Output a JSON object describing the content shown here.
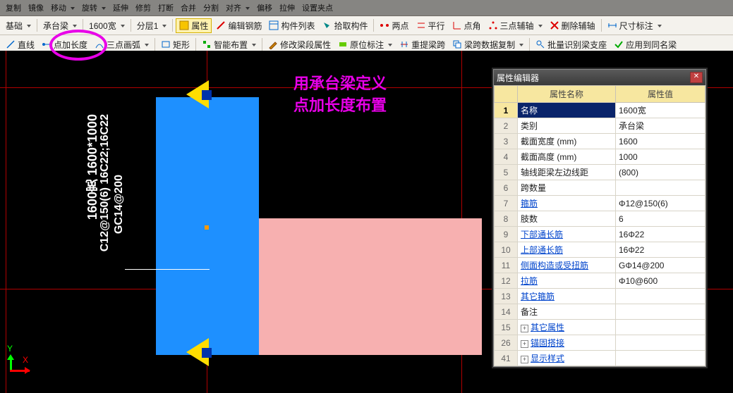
{
  "tb_top": {
    "items": [
      "复制",
      "镜像",
      "移动",
      "旋转",
      "延伸",
      "修剪",
      "打断",
      "合并",
      "分割",
      "对齐",
      "偏移",
      "拉伸",
      "设置夹点"
    ]
  },
  "tb1": {
    "a": "基础",
    "b": "承台梁",
    "c": "1600宽",
    "d": "分层1",
    "prop": "属性",
    "items": [
      "编辑钢筋",
      "构件列表",
      "拾取构件",
      "两点",
      "平行",
      "点角",
      "三点辅轴",
      "删除辅轴",
      "尺寸标注"
    ]
  },
  "tb2": {
    "a": "直线",
    "b": "点加长度",
    "c": "三点画弧",
    "d": "矩形",
    "items": [
      "智能布置",
      "修改梁段属性",
      "原位标注",
      "重提梁跨",
      "梁跨数据复制",
      "批量识别梁支座",
      "应用到同名梁"
    ]
  },
  "anno": {
    "l1": "用承台梁定义",
    "l2": "点加长度布置"
  },
  "vtxt": {
    "a": "1600宽 1600*1000",
    "b": "C12@150(6) 16C22;16C22",
    "c": "GC14@200"
  },
  "axis": {
    "x": "X",
    "y": "Y"
  },
  "panel": {
    "title": "属性编辑器",
    "h1": "属性名称",
    "h2": "属性值",
    "rows": [
      {
        "i": "1",
        "n": "名称",
        "v": "1600宽",
        "sel": true
      },
      {
        "i": "2",
        "n": "类别",
        "v": "承台梁"
      },
      {
        "i": "3",
        "n": "截面宽度 (mm)",
        "v": "1600"
      },
      {
        "i": "4",
        "n": "截面高度 (mm)",
        "v": "1000"
      },
      {
        "i": "5",
        "n": "轴线距梁左边线距",
        "v": "(800)"
      },
      {
        "i": "6",
        "n": "跨数量",
        "v": ""
      },
      {
        "i": "7",
        "n": "箍筋",
        "v": "Φ12@150(6)",
        "link": true
      },
      {
        "i": "8",
        "n": "肢数",
        "v": "6"
      },
      {
        "i": "9",
        "n": "下部通长筋",
        "v": "16Φ22",
        "link": true
      },
      {
        "i": "10",
        "n": "上部通长筋",
        "v": "16Φ22",
        "link": true
      },
      {
        "i": "11",
        "n": "侧面构造或受扭筋",
        "v": "GΦ14@200",
        "link": true
      },
      {
        "i": "12",
        "n": "拉筋",
        "v": "Φ10@600",
        "link": true
      },
      {
        "i": "13",
        "n": "其它箍筋",
        "v": "",
        "link": true
      },
      {
        "i": "14",
        "n": "备注",
        "v": ""
      },
      {
        "i": "15",
        "n": "其它属性",
        "v": "",
        "plus": true,
        "link": true
      },
      {
        "i": "26",
        "n": "锚固搭接",
        "v": "",
        "plus": true,
        "link": true
      },
      {
        "i": "41",
        "n": "显示样式",
        "v": "",
        "plus": true,
        "link": true
      }
    ]
  }
}
